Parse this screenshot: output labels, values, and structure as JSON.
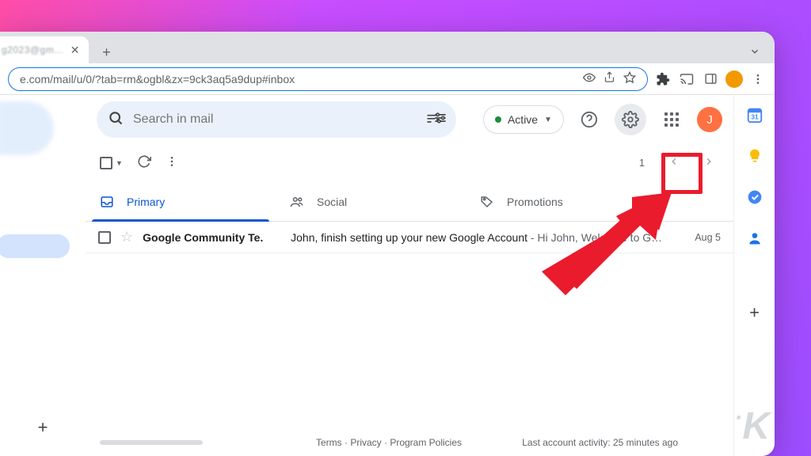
{
  "browser": {
    "tab_label": "g2023@gm…",
    "url": "e.com/mail/u/0/?tab=rm&ogbl&zx=9ck3aq5a9dup#inbox"
  },
  "gmail": {
    "search_placeholder": "Search in mail",
    "status_chip": "Active",
    "avatar_initial": "J",
    "page_info": "1",
    "tabs": {
      "primary": "Primary",
      "social": "Social",
      "promotions": "Promotions"
    },
    "rows": [
      {
        "from": "Google Community Te.",
        "subject": "John, finish setting up your new Google Account",
        "snippet_sep": " - ",
        "snippet": "Hi John, Welcome to G…",
        "date": "Aug 5"
      }
    ],
    "footer": {
      "terms": "Terms",
      "dot1": " · ",
      "privacy": "Privacy",
      "dot2": " · ",
      "policies": "Program Policies",
      "activity": "Last account activity: 25 minutes ago"
    }
  }
}
